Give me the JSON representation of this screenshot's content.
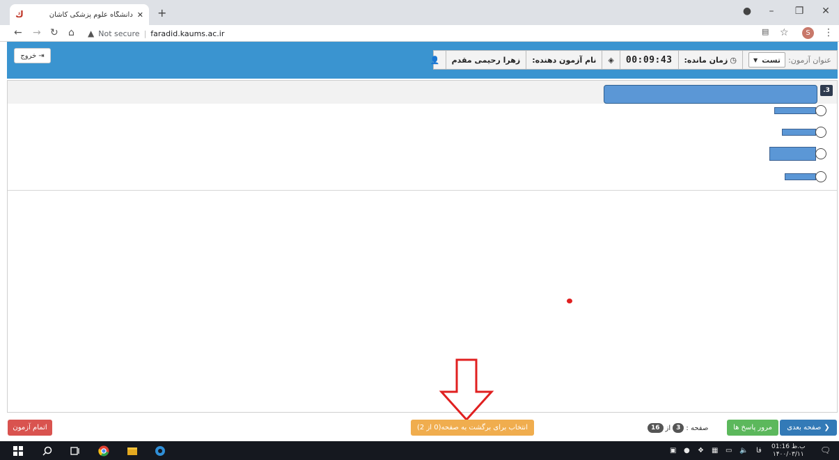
{
  "browser": {
    "tab_title": "دانشگاه علوم پزشکی کاشان",
    "new_tab": "+",
    "not_secure": "Not secure",
    "url": "faradid.kaums.ac.ir",
    "profile_initial": "S"
  },
  "header": {
    "exit_label": "خروج",
    "exam_title_label": "عنوان آزمون:",
    "exam_title_value": "تست",
    "time_left_label": "زمان مانده:",
    "timer": "00:09:43",
    "examinee_label": "نام آزمون دهنده:",
    "examinee_name": "زهرا رحیمی مقدم"
  },
  "question": {
    "number": ".3"
  },
  "footer": {
    "finish_label": "اتمام آزمون",
    "back_label": "انتخاب برای برگشت به صفحه(0 از 2)",
    "review_label": "مرور پاسخ ها",
    "next_label": "صفحه بعدی",
    "page_label": "صفحه :",
    "page_current": "3",
    "page_of": "از",
    "page_total": "16"
  },
  "taskbar": {
    "time": "01:16 ب.ظ",
    "date": "۱۴۰۰/۰۳/۱۱",
    "lang": "فا"
  },
  "colors": {
    "header_blue": "#3a94d0",
    "finish_red": "#d9534f",
    "back_orange": "#f0ad4e",
    "review_green": "#5cb85c",
    "next_blue": "#337ab7",
    "annotation_red": "#e02020"
  }
}
